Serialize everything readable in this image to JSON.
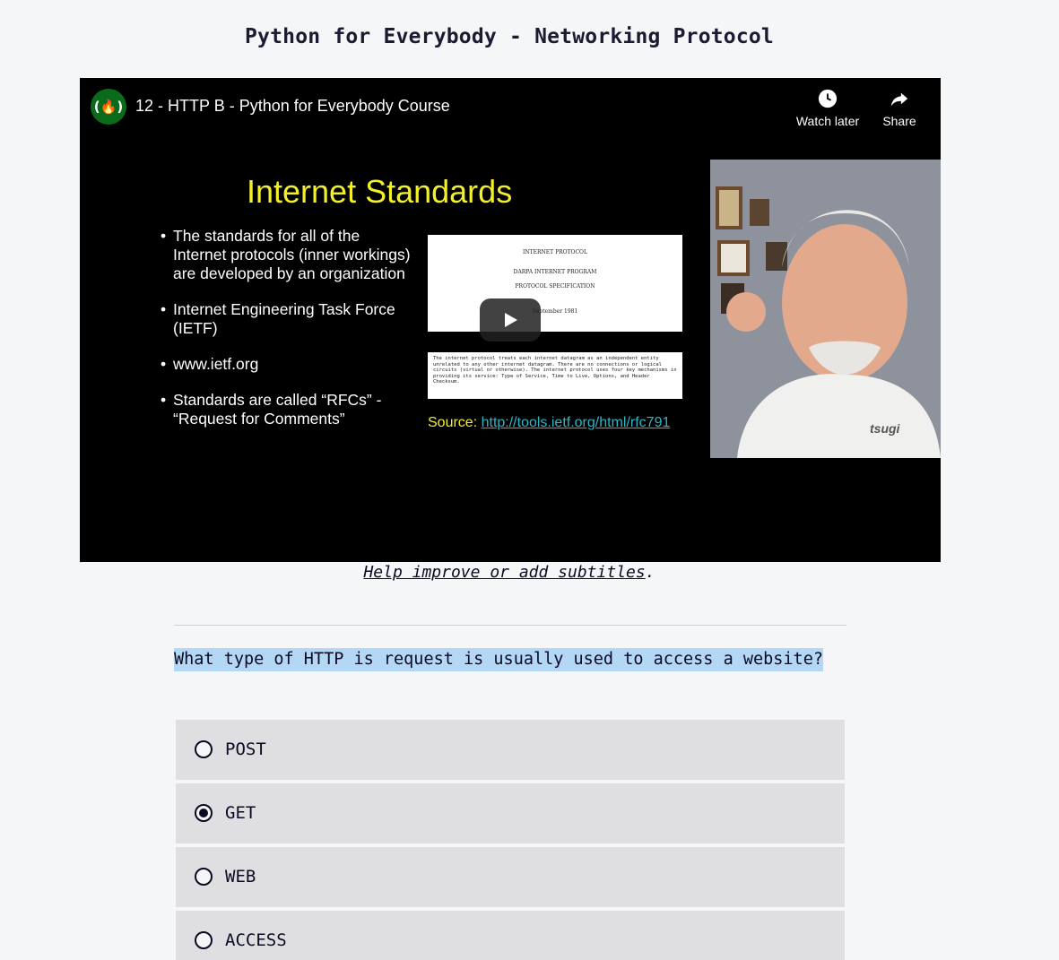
{
  "page": {
    "title": "Python for Everybody - Networking Protocol"
  },
  "video": {
    "channel_logo": "(🔥)",
    "title": "12 - HTTP B - Python for Everybody Course",
    "watch_later_label": "Watch later",
    "share_label": "Share",
    "slide": {
      "heading": "Internet Standards",
      "bullets": [
        "The standards for all of the Internet protocols (inner workings) are developed by an organization",
        "Internet Engineering Task Force (IETF)",
        "www.ietf.org",
        "Standards are called “RFCs” - “Request for Comments”"
      ],
      "doc_lines": [
        "INTERNET PROTOCOL",
        "DARPA INTERNET PROGRAM",
        "PROTOCOL SPECIFICATION",
        "September 1981"
      ],
      "doc_text": "The internet protocol treats each internet datagram as an independent entity unrelated to any other internet datagram. There are no connections or logical circuits (virtual or otherwise). The internet protocol uses four key mechanisms in providing its service: Type of Service, Time to Live, Options, and Header Checksum.",
      "source_label": "Source:",
      "source_link": "http://tools.ietf.org/html/rfc791"
    },
    "presenter_shirt_logo": "tsugi"
  },
  "subtitles": {
    "link_text": "Help improve or add subtitles",
    "suffix": "."
  },
  "quiz": {
    "question": "What type of HTTP is request is usually used to access a website?",
    "options": [
      {
        "label": "POST",
        "selected": false
      },
      {
        "label": "GET",
        "selected": true
      },
      {
        "label": "WEB",
        "selected": false
      },
      {
        "label": "ACCESS",
        "selected": false
      }
    ]
  }
}
